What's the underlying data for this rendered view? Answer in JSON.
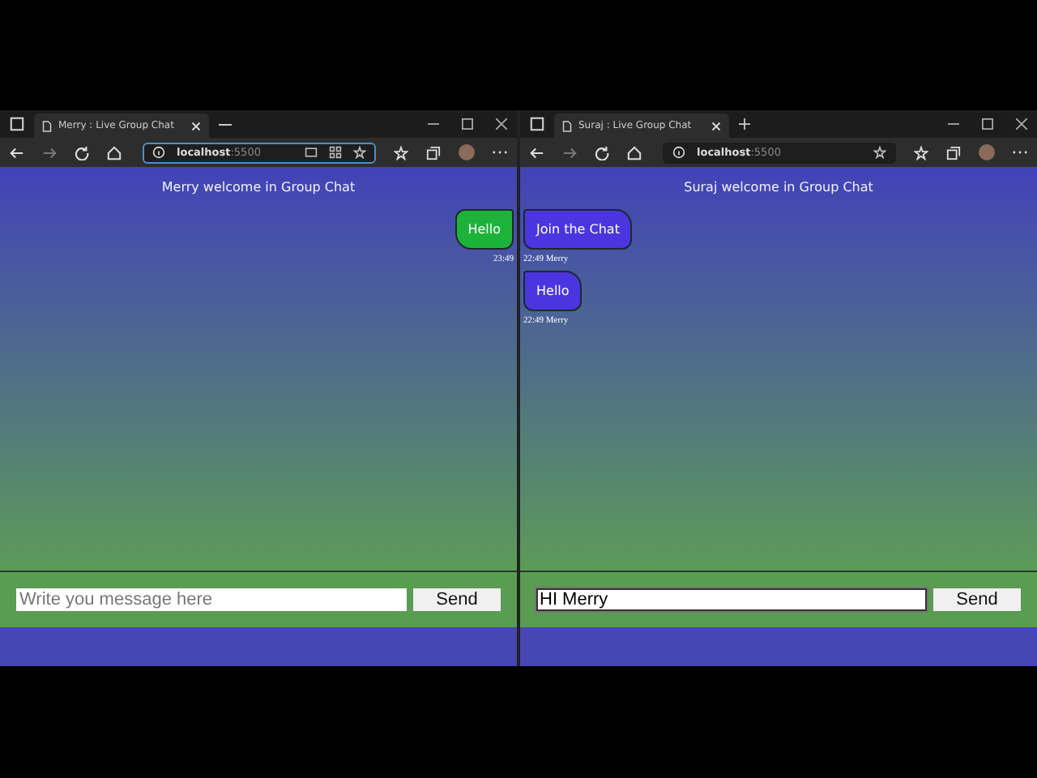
{
  "windows": [
    {
      "tab_title": "Merry : Live Group Chat",
      "plus_tab_button": false,
      "address": {
        "host": "localhost",
        "port": ":5500",
        "focused": true,
        "extra_icons": true
      },
      "heading": "Merry welcome in Group Chat",
      "messages": [
        {
          "kind": "outgoing",
          "text": "Hello",
          "meta": "23:49"
        }
      ],
      "input": {
        "placeholder": "Write you message here",
        "focused": false
      },
      "send_label": "Send"
    },
    {
      "tab_title": "Suraj : Live Group Chat",
      "plus_tab_button": true,
      "address": {
        "host": "localhost",
        "port": ":5500",
        "focused": false,
        "extra_icons": false
      },
      "heading": "Suraj welcome in Group Chat",
      "messages": [
        {
          "kind": "incoming",
          "text": "Join the Chat",
          "meta": "22:49 Merry"
        },
        {
          "kind": "incoming",
          "text": "Hello",
          "meta": "22:49 Merry"
        }
      ],
      "input": {
        "value": "HI Merry",
        "focused": true
      },
      "send_label": "Send"
    }
  ]
}
